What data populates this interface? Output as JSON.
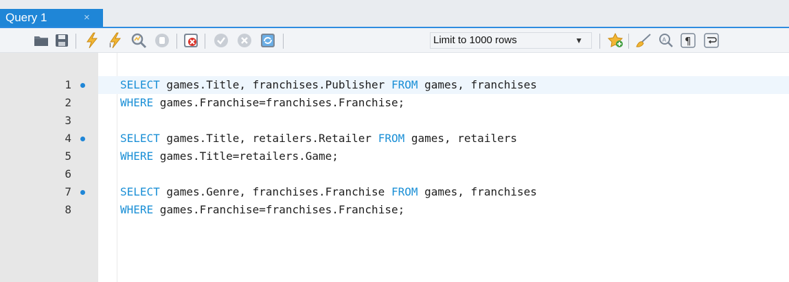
{
  "tab": {
    "title": "Query 1",
    "close": "×"
  },
  "toolbar": {
    "icons": [
      "open-folder-icon",
      "save-icon",
      "execute-icon",
      "execute-current-icon",
      "explain-icon",
      "stop-icon",
      "toggle-error-icon",
      "commit-icon",
      "rollback-icon",
      "autocommit-icon",
      "add-snippet-icon",
      "beautify-icon",
      "find-icon",
      "invisible-chars-icon",
      "wrap-icon"
    ],
    "limit": {
      "selected": "Limit to 1000 rows"
    }
  },
  "editor": {
    "lines": [
      {
        "num": "1",
        "marker": true,
        "tokens": [
          {
            "t": "SELECT",
            "kw": true
          },
          {
            "t": " games.Title, franchises.Publisher ",
            "kw": false
          },
          {
            "t": "FROM",
            "kw": true
          },
          {
            "t": " games, franchises",
            "kw": false
          }
        ]
      },
      {
        "num": "2",
        "marker": false,
        "tokens": [
          {
            "t": "WHERE",
            "kw": true
          },
          {
            "t": " games.Franchise=franchises.Franchise;",
            "kw": false
          }
        ]
      },
      {
        "num": "3",
        "marker": false,
        "tokens": []
      },
      {
        "num": "4",
        "marker": true,
        "tokens": [
          {
            "t": "SELECT",
            "kw": true
          },
          {
            "t": " games.Title, retailers.Retailer ",
            "kw": false
          },
          {
            "t": "FROM",
            "kw": true
          },
          {
            "t": " games, retailers",
            "kw": false
          }
        ]
      },
      {
        "num": "5",
        "marker": false,
        "tokens": [
          {
            "t": "WHERE",
            "kw": true
          },
          {
            "t": " games.Title=retailers.Game;",
            "kw": false
          }
        ]
      },
      {
        "num": "6",
        "marker": false,
        "tokens": []
      },
      {
        "num": "7",
        "marker": true,
        "tokens": [
          {
            "t": "SELECT",
            "kw": true
          },
          {
            "t": " games.Genre, franchises.Franchise ",
            "kw": false
          },
          {
            "t": "FROM",
            "kw": true
          },
          {
            "t": " games, franchises",
            "kw": false
          }
        ]
      },
      {
        "num": "8",
        "marker": false,
        "tokens": [
          {
            "t": "WHERE",
            "kw": true
          },
          {
            "t": " games.Franchise=franchises.Franchise;",
            "kw": false
          }
        ]
      }
    ]
  },
  "colors": {
    "accent": "#1f86d7",
    "keyword": "#1a8fd6",
    "gutter": "#e7e7e7",
    "current_line": "#eef6fd"
  }
}
